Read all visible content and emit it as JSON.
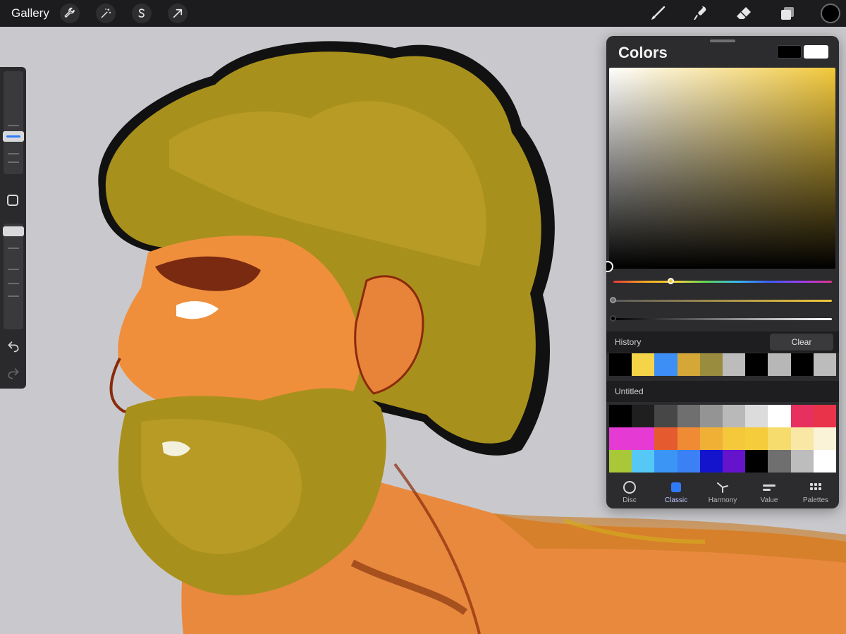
{
  "topbar": {
    "gallery_label": "Gallery",
    "left_actions": [
      {
        "name": "actions",
        "icon": "wrench-icon"
      },
      {
        "name": "adjustments",
        "icon": "magic-wand-icon"
      },
      {
        "name": "selection",
        "icon": "selection-s-icon"
      },
      {
        "name": "transform",
        "icon": "arrow-icon"
      }
    ],
    "right_tools": [
      {
        "name": "brush",
        "icon": "brush-icon"
      },
      {
        "name": "smudge",
        "icon": "smudge-icon"
      },
      {
        "name": "eraser",
        "icon": "eraser-icon"
      },
      {
        "name": "layers",
        "icon": "layers-icon"
      }
    ],
    "current_color": "#000000"
  },
  "sidebar": {
    "brush_size_icon": "slider-icon",
    "opacity_icon": "slider-icon",
    "modify_icon": "square-icon",
    "undo_icon": "undo-icon",
    "redo_icon": "redo-icon"
  },
  "colors_panel": {
    "title": "Colors",
    "primary_color": "#000000",
    "secondary_color": "#ffffff",
    "hue_color": "#f2c83a",
    "history_label": "History",
    "clear_label": "Clear",
    "history": [
      "#000000",
      "#f5d547",
      "#3d8ef5",
      "#d4a737",
      "#9a8c3e",
      "#bcbcbc",
      "#000000",
      "#b7b7b7",
      "#000000",
      "#bcbcbc"
    ],
    "palette_name": "Untitled",
    "palette": [
      "#000000",
      "#1f1f1f",
      "#474747",
      "#6f6f6f",
      "#949494",
      "#b9b9b9",
      "#dcdcdc",
      "#ffffff",
      "#e8305f",
      "#e8334a",
      "#e53ad4",
      "#e53ad4",
      "#e65a2f",
      "#ef8b34",
      "#efb035",
      "#f5c73b",
      "#f5cc3b",
      "#f6dc6c",
      "#f8e7a5",
      "#fbf3d7",
      "#a8c838",
      "#55c8f5",
      "#3b95f5",
      "#3b80f5",
      "#1414cc",
      "#6614cc",
      "#000000",
      "#6f6f6f",
      "#bdbdbd",
      "#ffffff"
    ],
    "tabs": [
      {
        "label": "Disc",
        "icon": "disc-icon"
      },
      {
        "label": "Classic",
        "icon": "classic-square-icon"
      },
      {
        "label": "Harmony",
        "icon": "harmony-icon"
      },
      {
        "label": "Value",
        "icon": "value-sliders-icon"
      },
      {
        "label": "Palettes",
        "icon": "palettes-grid-icon"
      }
    ],
    "active_tab": "Classic"
  }
}
